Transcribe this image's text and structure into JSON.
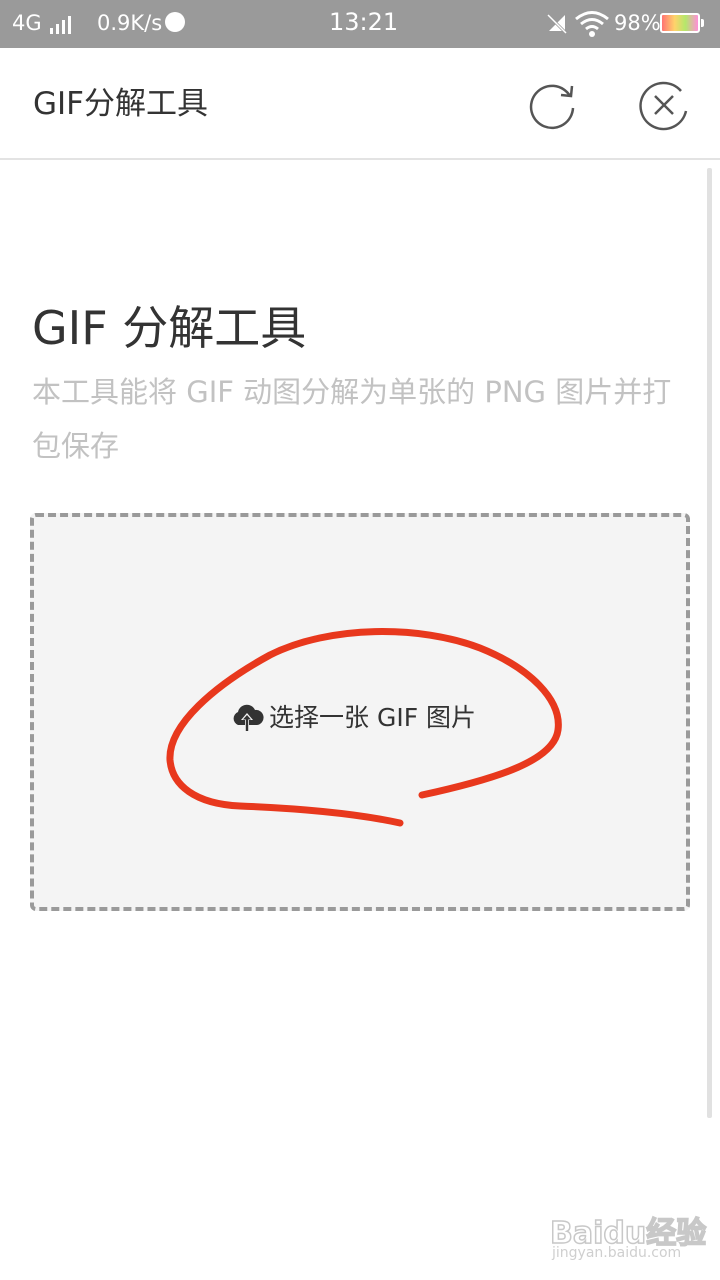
{
  "status_bar": {
    "network": "4G",
    "speed": "0.9K/s",
    "time": "13:21",
    "battery": "98%"
  },
  "header": {
    "title": "GIF分解工具",
    "icons": [
      "refresh-icon",
      "close-icon"
    ]
  },
  "main": {
    "title": "GIF 分解工具",
    "description": "本工具能将 GIF 动图分解为单张的 PNG 图片并打包保存",
    "upload": {
      "label": "选择一张 GIF 图片",
      "icon": "cloud-upload-icon"
    }
  },
  "annotation": {
    "color": "#e8381d"
  },
  "watermark": {
    "brand": "Baidu经验",
    "domain": "jingyan.baidu.com"
  }
}
